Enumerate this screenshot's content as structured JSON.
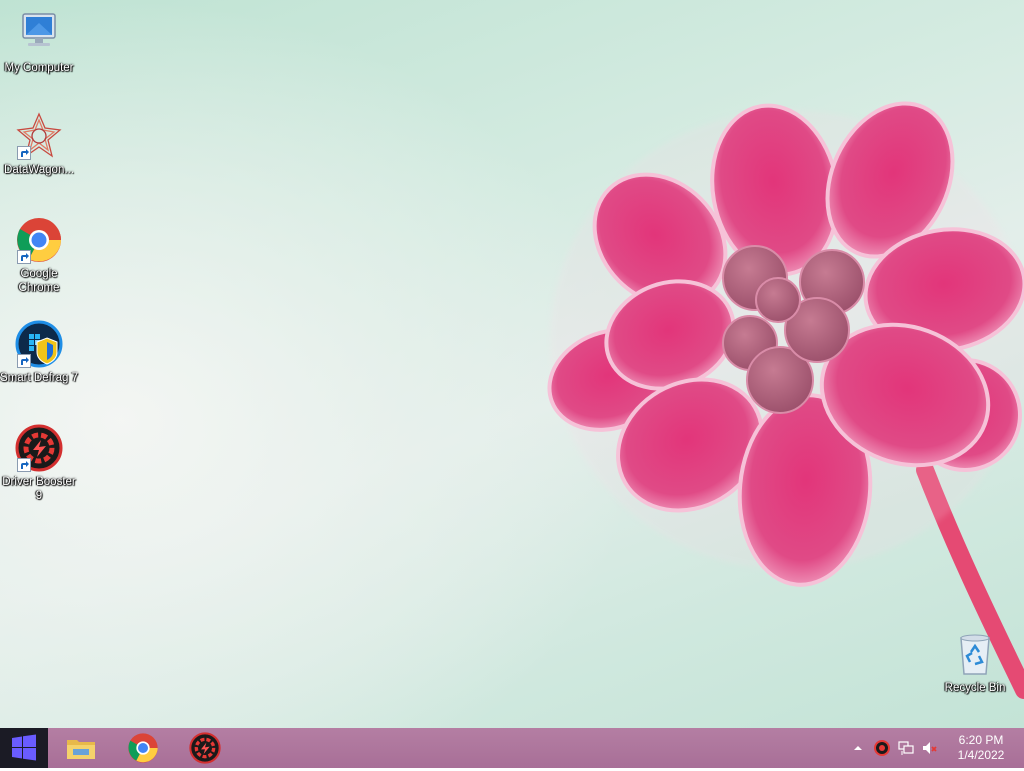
{
  "desktop": {
    "icons": [
      {
        "id": "my-computer",
        "label": "My Computer"
      },
      {
        "id": "datawagon",
        "label": "DataWagon..."
      },
      {
        "id": "google-chrome",
        "label": "Google Chrome"
      },
      {
        "id": "smart-defrag",
        "label": "Smart Defrag 7"
      },
      {
        "id": "driver-booster",
        "label": "Driver Booster 9"
      },
      {
        "id": "recycle-bin",
        "label": "Recycle Bin"
      }
    ]
  },
  "taskbar": {
    "start_icon": "windows-logo-icon",
    "pinned": [
      {
        "name": "File Explorer",
        "icon": "folder-icon"
      },
      {
        "name": "Google Chrome",
        "icon": "chrome-icon"
      },
      {
        "name": "Driver Booster",
        "icon": "driver-booster-icon"
      }
    ],
    "tray": {
      "icons": [
        "chevron-up-icon",
        "driver-booster-tray-icon",
        "network-icon",
        "volume-muted-icon"
      ],
      "time": "6:20 PM",
      "date": "1/4/2022"
    }
  },
  "colors": {
    "flower": "#e0407a",
    "taskbar": "#ad7499",
    "start": "#1b1b25"
  }
}
